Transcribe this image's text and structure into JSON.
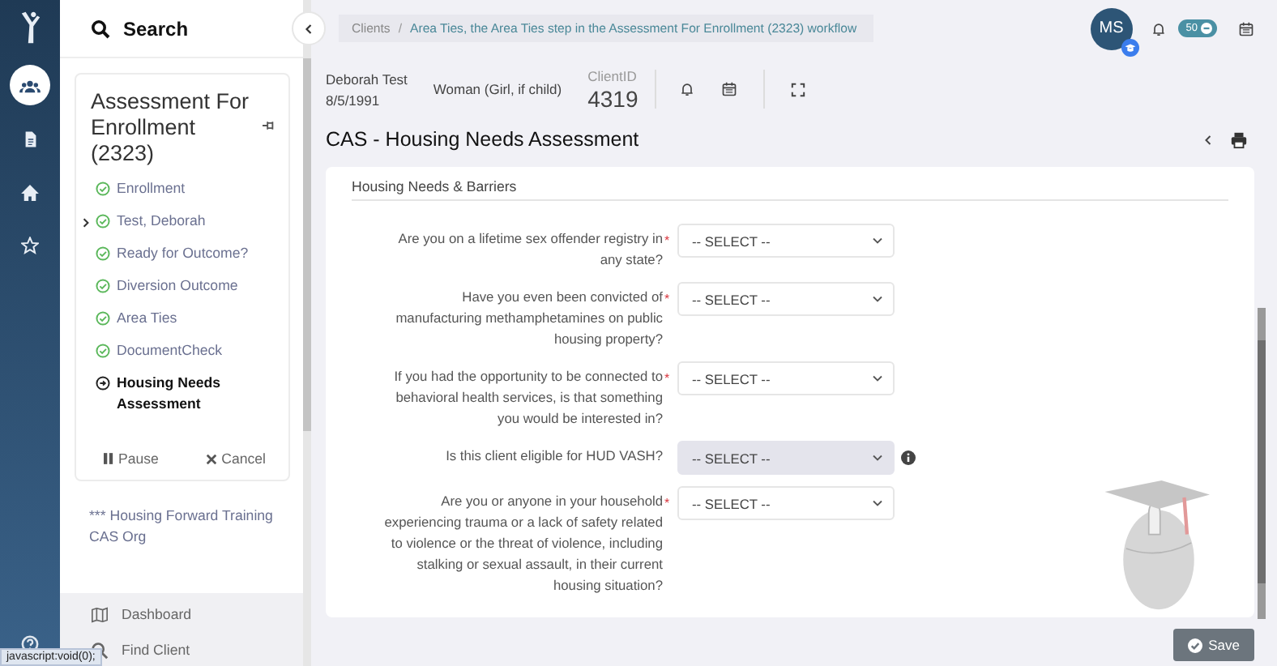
{
  "rail": {
    "items": [
      {
        "kind": "people",
        "selected": true
      },
      {
        "kind": "document",
        "selected": false
      },
      {
        "kind": "home",
        "selected": false
      },
      {
        "kind": "star",
        "selected": false
      }
    ]
  },
  "sidebar": {
    "search_label": "Search",
    "workflow": {
      "title": "Assessment For Enrollment (2323)",
      "steps": [
        {
          "label": "Enrollment",
          "done": true,
          "selected": false
        },
        {
          "label": "Test, Deborah",
          "done": true,
          "selected": true
        },
        {
          "label": "Ready for Outcome?",
          "done": true,
          "selected": false
        },
        {
          "label": "Diversion Outcome",
          "done": true,
          "selected": false
        },
        {
          "label": "Area Ties",
          "done": true,
          "selected": false
        },
        {
          "label": "DocumentCheck",
          "done": true,
          "selected": false
        },
        {
          "label": "Housing Needs Assessment",
          "done": false,
          "selected": false
        }
      ],
      "actions": [
        {
          "kind": "pause",
          "label": "Pause"
        },
        {
          "kind": "cancel",
          "label": "Cancel"
        }
      ]
    },
    "org": "*** Housing Forward Training CAS Org",
    "nav": [
      {
        "kind": "map",
        "label": "Dashboard"
      },
      {
        "kind": "search",
        "label": "Find Client"
      }
    ]
  },
  "breadcrumb": {
    "items": [
      "Clients",
      "Area Ties, the Area Ties step in the Assessment For Enrollment (2323) workflow"
    ],
    "separator": "/"
  },
  "user": {
    "initials": "MS",
    "notifications": "50"
  },
  "client": {
    "name": "Deborah Test",
    "dob": "8/5/1991",
    "gender": "Woman (Girl, if child)",
    "id_label": "ClientID",
    "id": "4319"
  },
  "page_title": "CAS - Housing Needs Assessment",
  "form": {
    "section": "Housing Needs & Barriers",
    "questions": [
      {
        "label": "Are you on a lifetime sex offender registry in any state?",
        "required_mark": "*",
        "value": "-- SELECT --",
        "disabled": false,
        "info": false
      },
      {
        "label": "Have you even been convicted of manufacturing methamphetamines on public housing property?",
        "required_mark": "*",
        "value": "-- SELECT --",
        "disabled": false,
        "info": false
      },
      {
        "label": "If you had the opportunity to be connected to behavioral health services, is that something you would be interested in?",
        "required_mark": "*",
        "value": "-- SELECT --",
        "disabled": false,
        "info": false
      },
      {
        "label": "Is this client eligible for HUD VASH?",
        "value": "-- SELECT --",
        "disabled": true,
        "info": true
      },
      {
        "label": "Are you or anyone in your household experiencing trauma or a lack of safety related to violence or the threat of violence, including stalking or sexual assault, in their current housing situation?",
        "required_mark": "*",
        "value": "-- SELECT --",
        "disabled": false,
        "info": false
      }
    ]
  },
  "save_label": "Save",
  "status_url": "javascript:void(0);"
}
